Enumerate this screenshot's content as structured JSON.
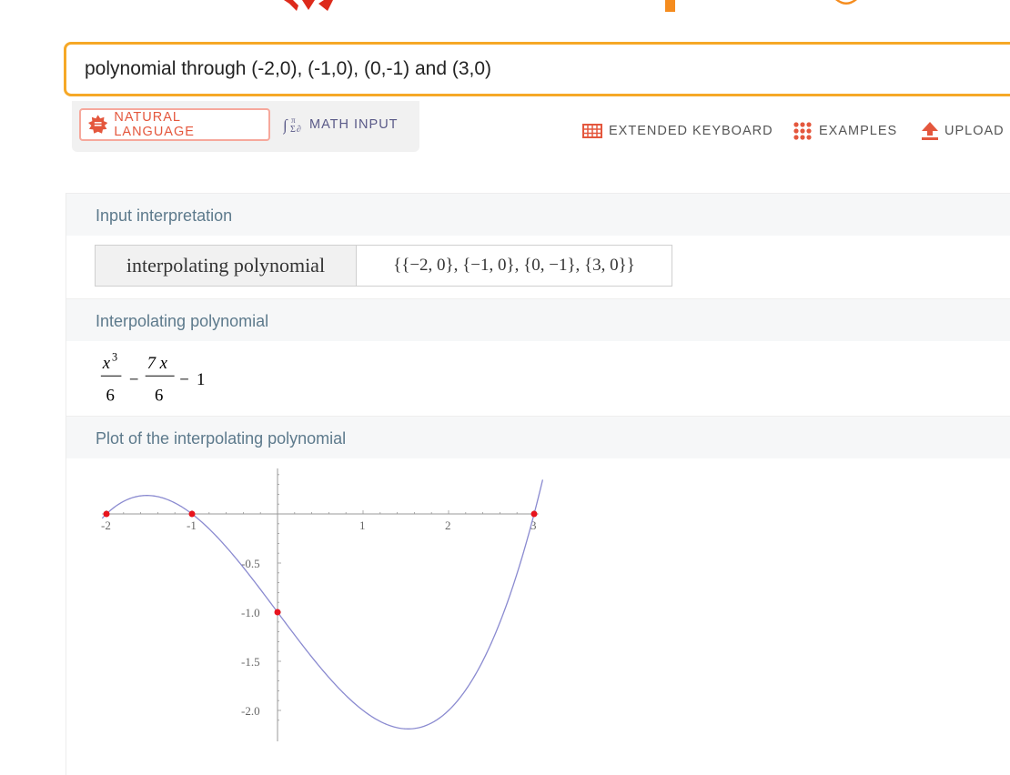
{
  "search": {
    "value": "polynomial through (-2,0), (-1,0), (0,-1) and (3,0)"
  },
  "mode_switch": {
    "natural_label": "NATURAL LANGUAGE",
    "math_label": "MATH INPUT"
  },
  "toolbar": {
    "keyboard_label": "EXTENDED KEYBOARD",
    "examples_label": "EXAMPLES",
    "upload_label": "UPLOAD"
  },
  "pods": {
    "input_title": "Input interpretation",
    "interp_label": "interpolating polynomial",
    "interp_value": "{{−2, 0}, {−1, 0}, {0, −1}, {3, 0}}",
    "poly_title": "Interpolating polynomial",
    "plot_title": "Plot of the interpolating polynomial"
  },
  "formula": {
    "term1_num": "x",
    "term1_exp": "3",
    "term1_den": "6",
    "minus1": "−",
    "term2_num": "7 x",
    "term2_den": "6",
    "minus2": "−",
    "const": "1"
  },
  "colors": {
    "accent_orange": "#f6a827",
    "natural_red": "#e4573d",
    "pod_title": "#5d7a8c",
    "curve": "#8a8ad0",
    "point": "#e8141e"
  },
  "chart_data": {
    "type": "line",
    "function": "x^3/6 - 7x/6 - 1",
    "xlim": [
      -2,
      3.1
    ],
    "ylim": [
      -2.25,
      0.5
    ],
    "x_ticks": [
      "-2",
      "-1",
      "1",
      "2",
      "3"
    ],
    "y_ticks": [
      "-0.5",
      "-1.0",
      "-1.5",
      "-2.0"
    ],
    "points": [
      {
        "x": -2,
        "y": 0
      },
      {
        "x": -1,
        "y": 0
      },
      {
        "x": 0,
        "y": -1
      },
      {
        "x": 3,
        "y": 0
      }
    ]
  }
}
